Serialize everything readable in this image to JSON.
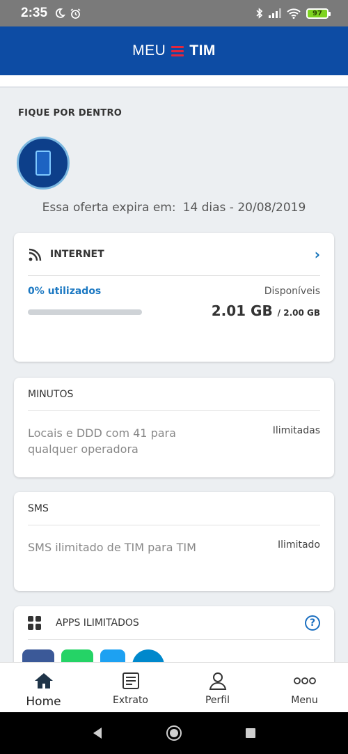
{
  "status_bar": {
    "time": "2:35",
    "battery": "97"
  },
  "app": {
    "brand_left": "MEU",
    "brand_right": "TIM"
  },
  "section": {
    "title": "FIQUE POR DENTRO"
  },
  "offer": {
    "label": "Essa oferta expira em:",
    "dates": "14 dias - 20/08/2019"
  },
  "internet": {
    "title": "INTERNET",
    "used_label": "0% utilizados",
    "used_fraction": 0,
    "available_label": "Disponíveis",
    "available": "2.01 GB",
    "total": "/ 2.00 GB"
  },
  "minutes": {
    "title": "MINUTOS",
    "desc": "Locais e DDD com 41 para qualquer operadora",
    "value": "Ilimitadas"
  },
  "sms": {
    "title": "SMS",
    "desc": "SMS ilimitado de TIM para TIM",
    "value": "Ilimitado"
  },
  "apps": {
    "title": "APPS ILIMITADOS",
    "help": "?"
  },
  "nav": [
    {
      "label": "Home",
      "icon": "home-icon"
    },
    {
      "label": "Extrato",
      "icon": "receipt-icon"
    },
    {
      "label": "Perfil",
      "icon": "user-icon"
    },
    {
      "label": "Menu",
      "icon": "more-icon"
    }
  ],
  "colors": {
    "brand_blue": "#0d4ca4",
    "accent_blue": "#1b78c2",
    "tim_red": "#e3263c"
  }
}
